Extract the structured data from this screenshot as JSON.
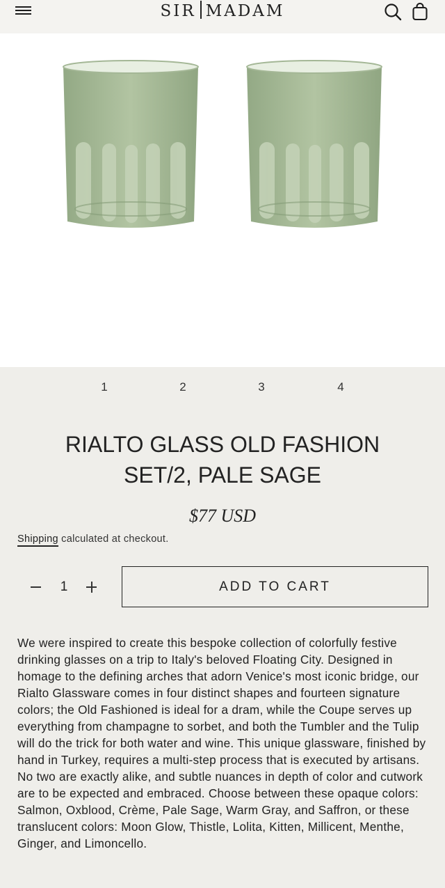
{
  "header": {
    "logo_left": "SIR",
    "logo_right": "MADAM",
    "icons": {
      "menu": "hamburger-menu-icon",
      "search": "search-icon",
      "cart": "shopping-bag-icon"
    }
  },
  "gallery": {
    "images": [
      {
        "name": "rialto-glass-left",
        "color": "#a8bc98"
      },
      {
        "name": "rialto-glass-right",
        "color": "#a8bc98"
      }
    ],
    "pages": [
      "1",
      "2",
      "3",
      "4"
    ]
  },
  "product": {
    "title_line1": "RIALTO GLASS OLD FASHION",
    "title_line2": "SET/2, PALE SAGE",
    "price": "$77 USD",
    "shipping_link": "Shipping",
    "shipping_rest": " calculated at checkout.",
    "quantity": "1",
    "add_to_cart": "ADD TO CART",
    "description": "We were inspired to create this bespoke collection of colorfully festive drinking glasses on a trip to Italy's beloved Floating City. Designed in homage to the defining arches that adorn Venice's most iconic bridge, our Rialto Glassware comes in four distinct shapes and fourteen signature colors; the Old Fashioned is ideal for a dram, while the Coupe serves up everything from champagne to sorbet, and both the Tumbler and the Tulip will do the trick for both water and wine. This unique glassware, finished by hand in Turkey, requires a multi-step process that is executed by artisans. No two are exactly alike, and subtle nuances in depth of color and cutwork are to be expected and embraced. Choose between these opaque colors: Salmon, Oxblood, Crème, Pale Sage, Warm Gray, and Saffron, or these translucent colors: Moon Glow, Thistle, Lolita, Kitten, Millicent, Menthe, Ginger, and Limoncello."
  }
}
